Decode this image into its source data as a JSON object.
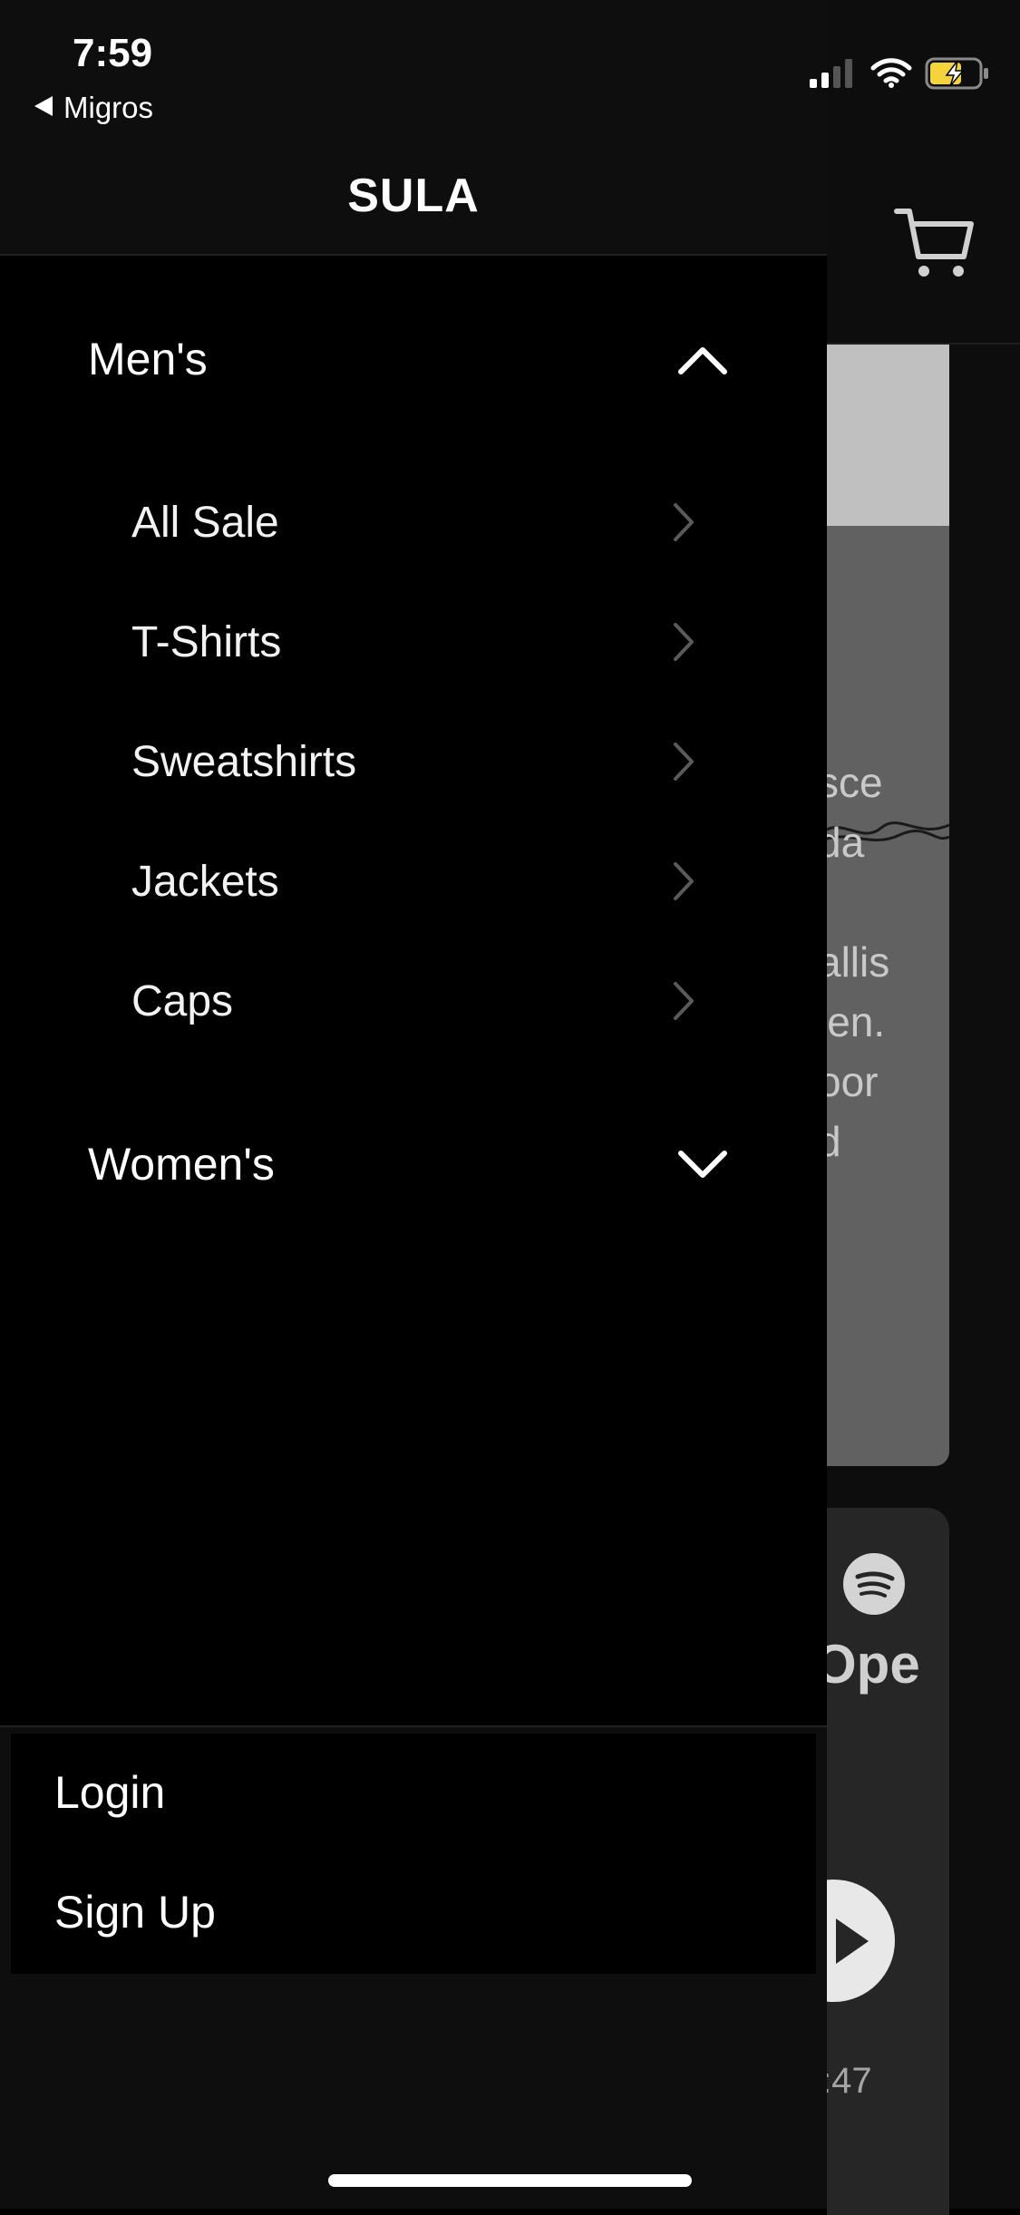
{
  "status_bar": {
    "time": "7:59",
    "back_app": "Migros"
  },
  "drawer": {
    "title": "SULA",
    "categories": [
      {
        "label": "Men's",
        "expanded": true,
        "items": [
          {
            "label": "All Sale"
          },
          {
            "label": "T-Shirts"
          },
          {
            "label": "Sweatshirts"
          },
          {
            "label": "Jackets"
          },
          {
            "label": "Caps"
          }
        ]
      },
      {
        "label": "Women's",
        "expanded": false,
        "items": []
      }
    ],
    "auth": {
      "login": "Login",
      "signup": "Sign Up"
    }
  },
  "background_page": {
    "card_text": [
      "sce",
      "da",
      "allis",
      "ien.",
      "oor",
      "d"
    ],
    "player_title": "Ope",
    "player_time": ":47"
  },
  "icons": {
    "cart": "cart-icon",
    "chevron_up": "chevron-up-icon",
    "chevron_down": "chevron-down-icon",
    "chevron_right": "chevron-right-icon",
    "spotify": "spotify-icon",
    "play": "play-icon"
  },
  "colors": {
    "drawer_bg": "#000000",
    "header_bg": "#0e0e0e",
    "chevron_muted": "#5a5a5a",
    "battery_charge": "#f5d33a"
  }
}
